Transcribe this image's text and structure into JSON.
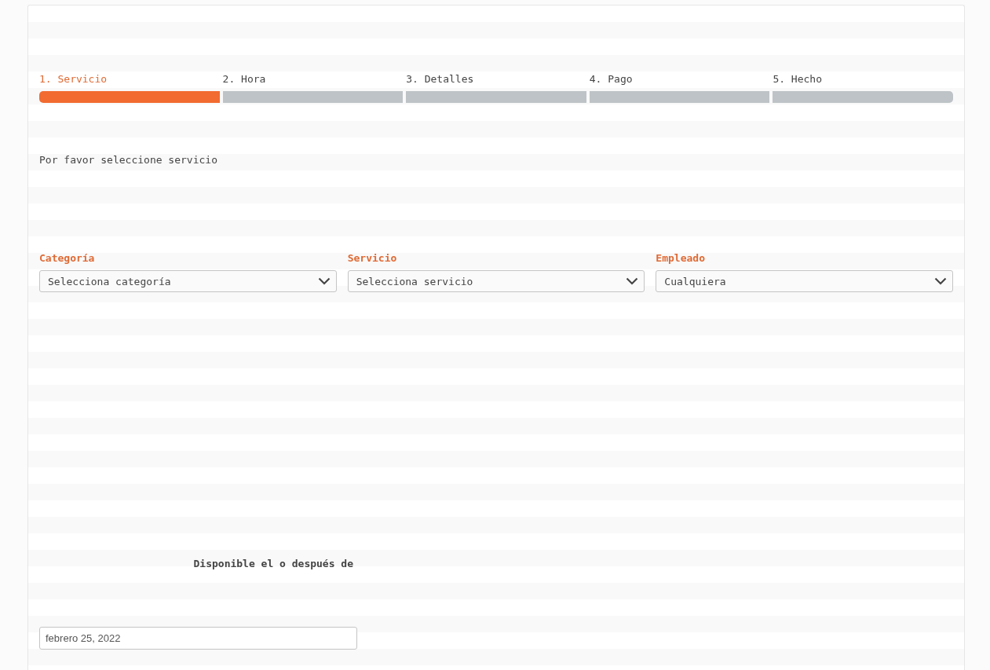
{
  "steps": [
    {
      "label": "1. Servicio",
      "selected": true
    },
    {
      "label": "2. Hora",
      "selected": false
    },
    {
      "label": "3. Detalles",
      "selected": false
    },
    {
      "label": "4. Pago",
      "selected": false
    },
    {
      "label": "5. Hecho",
      "selected": false
    }
  ],
  "intro": "Por favor seleccione servicio",
  "filters": [
    {
      "label": "Categoría",
      "value": "Selecciona categoría"
    },
    {
      "label": "Servicio",
      "value": "Selecciona servicio"
    },
    {
      "label": "Empleado",
      "value": "Cualquiera"
    }
  ],
  "date_filter": {
    "label": "Disponible el o después de",
    "value": "febrero 25, 2022"
  }
}
